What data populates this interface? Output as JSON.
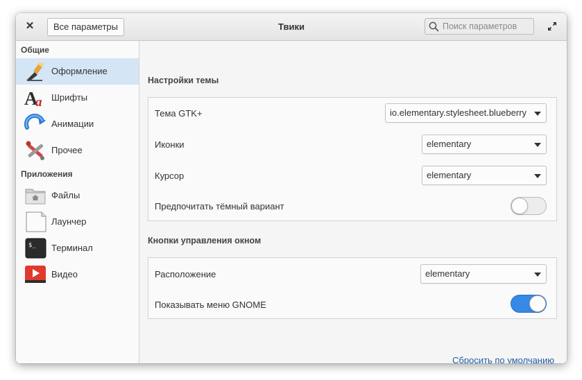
{
  "window": {
    "title": "Твики"
  },
  "header": {
    "back_label": "Все параметры",
    "search_placeholder": "Поиск параметров"
  },
  "sidebar": {
    "sections": [
      {
        "title": "Общие",
        "items": [
          {
            "label": "Оформление",
            "icon": "appearance-brush-icon",
            "selected": true
          },
          {
            "label": "Шрифты",
            "icon": "fonts-icon",
            "selected": false
          },
          {
            "label": "Анимации",
            "icon": "animations-icon",
            "selected": false
          },
          {
            "label": "Прочее",
            "icon": "misc-tools-icon",
            "selected": false
          }
        ]
      },
      {
        "title": "Приложения",
        "items": [
          {
            "label": "Файлы",
            "icon": "folder-home-icon",
            "selected": false
          },
          {
            "label": "Лаунчер",
            "icon": "launcher-icon",
            "selected": false
          },
          {
            "label": "Терминал",
            "icon": "terminal-icon",
            "selected": false
          },
          {
            "label": "Видео",
            "icon": "video-icon",
            "selected": false
          }
        ]
      }
    ]
  },
  "main": {
    "theme": {
      "title": "Настройки темы",
      "gtk": {
        "label": "Тема GTK+",
        "value": "io.elementary.stylesheet.blueberry"
      },
      "icons": {
        "label": "Иконки",
        "value": "elementary"
      },
      "cursor": {
        "label": "Курсор",
        "value": "elementary"
      },
      "dark": {
        "label": "Предпочитать тёмный вариант",
        "enabled": false
      }
    },
    "buttons": {
      "title": "Кнопки управления окном",
      "layout": {
        "label": "Расположение",
        "value": "elementary"
      },
      "gnome_menu": {
        "label": "Показывать меню GNOME",
        "enabled": true
      }
    },
    "reset_label": "Сбросить по умолчанию"
  },
  "colors": {
    "accent": "#3689e6",
    "selection": "#d4e5f6",
    "link": "#1f5fa8"
  }
}
